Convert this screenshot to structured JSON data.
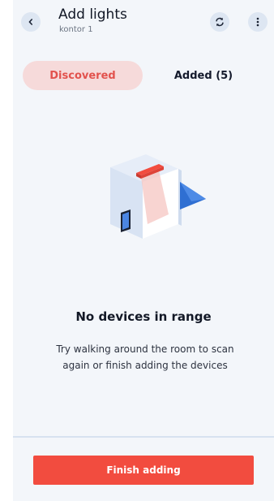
{
  "header": {
    "title": "Add lights",
    "subtitle": "kontor 1",
    "back_icon": "chevron-left-icon",
    "sync_icon": "sync-icon",
    "more_icon": "more-vertical-icon"
  },
  "tabs": [
    {
      "label": "Discovered",
      "selected": true
    },
    {
      "label": "Added (5)",
      "selected": false
    }
  ],
  "empty_state": {
    "illustration": "room-scan-illustration",
    "title": "No devices in range",
    "description": "Try walking around the room to scan again or finish adding the devices"
  },
  "footer": {
    "finish_label": "Finish adding"
  },
  "colors": {
    "accent": "#f24c3f",
    "tab_selected_bg": "#f6dada",
    "background": "#f3f6fa"
  }
}
